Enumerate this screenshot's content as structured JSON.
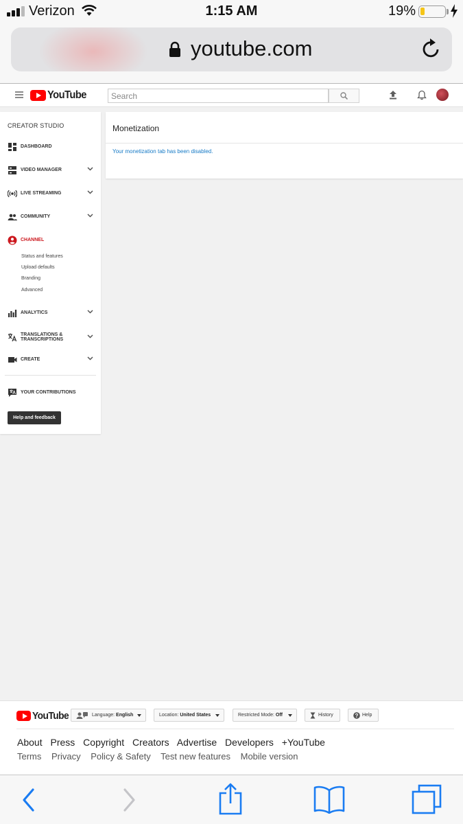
{
  "status_bar": {
    "carrier": "Verizon",
    "time": "1:15 AM",
    "battery_percent": "19%",
    "battery_level": 0.19,
    "signal_bars": 3
  },
  "browser": {
    "url": "youtube.com",
    "lock_icon": "lock-icon",
    "reload_icon": "reload-icon"
  },
  "masthead": {
    "logo_text": "YouTube",
    "search_placeholder": "Search",
    "icons": [
      "hamburger-icon",
      "search-icon",
      "upload-icon",
      "bell-icon",
      "avatar"
    ]
  },
  "sidebar": {
    "title": "CREATOR STUDIO",
    "items": [
      {
        "label": "DASHBOARD",
        "icon": "dashboard-icon",
        "expandable": false
      },
      {
        "label": "VIDEO MANAGER",
        "icon": "video-manager-icon",
        "expandable": true
      },
      {
        "label": "LIVE STREAMING",
        "icon": "live-streaming-icon",
        "expandable": true
      },
      {
        "label": "COMMUNITY",
        "icon": "community-icon",
        "expandable": true
      },
      {
        "label": "CHANNEL",
        "icon": "channel-icon",
        "expandable": false,
        "active": true
      },
      {
        "label": "ANALYTICS",
        "icon": "analytics-icon",
        "expandable": true
      },
      {
        "label": "TRANSLATIONS & TRANSCRIPTIONS",
        "icon": "translate-icon",
        "expandable": true
      },
      {
        "label": "CREATE",
        "icon": "create-icon",
        "expandable": true
      },
      {
        "label": "YOUR CONTRIBUTIONS",
        "icon": "contributions-icon",
        "expandable": false
      }
    ],
    "channel_subitems": [
      "Status and features",
      "Upload defaults",
      "Branding",
      "Advanced"
    ],
    "help_button": "Help and feedback"
  },
  "main": {
    "title": "Monetization",
    "message": "Your monetization tab has been disabled."
  },
  "footer": {
    "logo_text": "YouTube",
    "language_label": "Language:",
    "language_value": "English",
    "location_label": "Location:",
    "location_value": "United States",
    "restricted_label": "Restricted Mode:",
    "restricted_value": "Off",
    "history": "History",
    "help": "Help",
    "links_primary": [
      "About",
      "Press",
      "Copyright",
      "Creators",
      "Advertise",
      "Developers",
      "+YouTube"
    ],
    "links_secondary": [
      "Terms",
      "Privacy",
      "Policy & Safety",
      "Test new features",
      "Mobile version"
    ]
  },
  "toolbar": {
    "icons": [
      "back-icon",
      "forward-icon",
      "share-icon",
      "bookmarks-icon",
      "tabs-icon"
    ]
  },
  "colors": {
    "youtube_red": "#ff0000",
    "link_blue": "#167ac6",
    "active_red": "#cc181e",
    "ios_blue": "#1a7cf2"
  }
}
